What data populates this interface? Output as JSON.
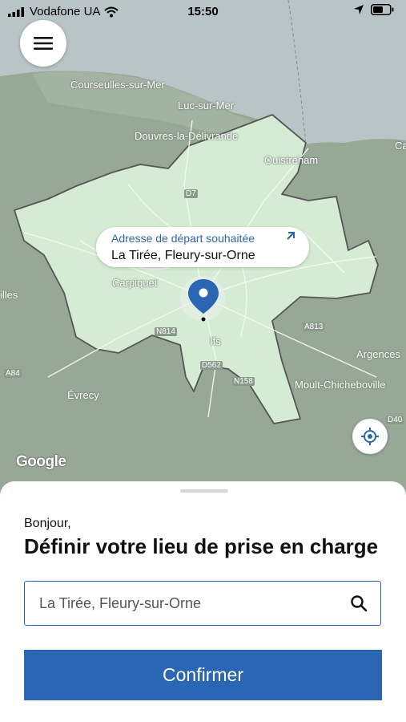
{
  "status_bar": {
    "carrier": "Vodafone UA",
    "time": "15:50"
  },
  "map": {
    "places": [
      "Courseulles-sur-Mer",
      "Luc-sur-Mer",
      "Douvres-la-Délivrande",
      "Ouistreham",
      "Carpiquet",
      "Ifs",
      "Argences",
      "Moult-Chicheboville",
      "Évrecy",
      "illes",
      "Ca"
    ],
    "roads": [
      "D7",
      "N814",
      "A813",
      "D562",
      "N158",
      "A84",
      "D40"
    ],
    "attribution": "Google",
    "colors": {
      "land": "#97a996",
      "zone": "#d5ebd3",
      "sea": "#b9c4c6",
      "zone_border": "#555555"
    }
  },
  "pickup_bubble": {
    "caption": "Adresse de départ souhaitée",
    "address": "La Tirée, Fleury-sur-Orne"
  },
  "sheet": {
    "greeting": "Bonjour,",
    "title": "Définir votre lieu de prise en charge",
    "address_value": "La Tirée, Fleury-sur-Orne",
    "confirm_label": "Confirmer"
  },
  "colors": {
    "accent": "#2a66b3"
  }
}
